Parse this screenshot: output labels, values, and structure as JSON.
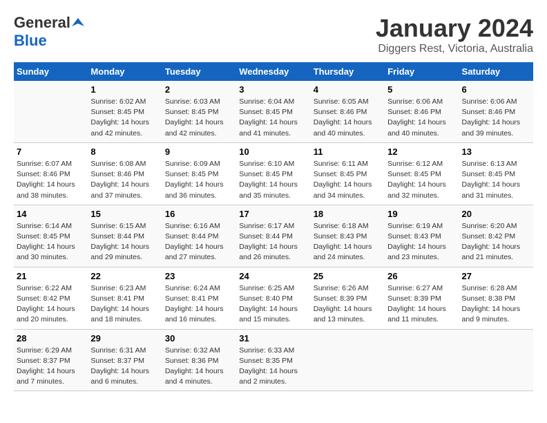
{
  "header": {
    "logo_general": "General",
    "logo_blue": "Blue",
    "title": "January 2024",
    "subtitle": "Diggers Rest, Victoria, Australia"
  },
  "days_of_week": [
    "Sunday",
    "Monday",
    "Tuesday",
    "Wednesday",
    "Thursday",
    "Friday",
    "Saturday"
  ],
  "weeks": [
    [
      {
        "day": "",
        "content": ""
      },
      {
        "day": "1",
        "content": "Sunrise: 6:02 AM\nSunset: 8:45 PM\nDaylight: 14 hours\nand 42 minutes."
      },
      {
        "day": "2",
        "content": "Sunrise: 6:03 AM\nSunset: 8:45 PM\nDaylight: 14 hours\nand 42 minutes."
      },
      {
        "day": "3",
        "content": "Sunrise: 6:04 AM\nSunset: 8:45 PM\nDaylight: 14 hours\nand 41 minutes."
      },
      {
        "day": "4",
        "content": "Sunrise: 6:05 AM\nSunset: 8:46 PM\nDaylight: 14 hours\nand 40 minutes."
      },
      {
        "day": "5",
        "content": "Sunrise: 6:06 AM\nSunset: 8:46 PM\nDaylight: 14 hours\nand 40 minutes."
      },
      {
        "day": "6",
        "content": "Sunrise: 6:06 AM\nSunset: 8:46 PM\nDaylight: 14 hours\nand 39 minutes."
      }
    ],
    [
      {
        "day": "7",
        "content": "Sunrise: 6:07 AM\nSunset: 8:46 PM\nDaylight: 14 hours\nand 38 minutes."
      },
      {
        "day": "8",
        "content": "Sunrise: 6:08 AM\nSunset: 8:46 PM\nDaylight: 14 hours\nand 37 minutes."
      },
      {
        "day": "9",
        "content": "Sunrise: 6:09 AM\nSunset: 8:45 PM\nDaylight: 14 hours\nand 36 minutes."
      },
      {
        "day": "10",
        "content": "Sunrise: 6:10 AM\nSunset: 8:45 PM\nDaylight: 14 hours\nand 35 minutes."
      },
      {
        "day": "11",
        "content": "Sunrise: 6:11 AM\nSunset: 8:45 PM\nDaylight: 14 hours\nand 34 minutes."
      },
      {
        "day": "12",
        "content": "Sunrise: 6:12 AM\nSunset: 8:45 PM\nDaylight: 14 hours\nand 32 minutes."
      },
      {
        "day": "13",
        "content": "Sunrise: 6:13 AM\nSunset: 8:45 PM\nDaylight: 14 hours\nand 31 minutes."
      }
    ],
    [
      {
        "day": "14",
        "content": "Sunrise: 6:14 AM\nSunset: 8:45 PM\nDaylight: 14 hours\nand 30 minutes."
      },
      {
        "day": "15",
        "content": "Sunrise: 6:15 AM\nSunset: 8:44 PM\nDaylight: 14 hours\nand 29 minutes."
      },
      {
        "day": "16",
        "content": "Sunrise: 6:16 AM\nSunset: 8:44 PM\nDaylight: 14 hours\nand 27 minutes."
      },
      {
        "day": "17",
        "content": "Sunrise: 6:17 AM\nSunset: 8:44 PM\nDaylight: 14 hours\nand 26 minutes."
      },
      {
        "day": "18",
        "content": "Sunrise: 6:18 AM\nSunset: 8:43 PM\nDaylight: 14 hours\nand 24 minutes."
      },
      {
        "day": "19",
        "content": "Sunrise: 6:19 AM\nSunset: 8:43 PM\nDaylight: 14 hours\nand 23 minutes."
      },
      {
        "day": "20",
        "content": "Sunrise: 6:20 AM\nSunset: 8:42 PM\nDaylight: 14 hours\nand 21 minutes."
      }
    ],
    [
      {
        "day": "21",
        "content": "Sunrise: 6:22 AM\nSunset: 8:42 PM\nDaylight: 14 hours\nand 20 minutes."
      },
      {
        "day": "22",
        "content": "Sunrise: 6:23 AM\nSunset: 8:41 PM\nDaylight: 14 hours\nand 18 minutes."
      },
      {
        "day": "23",
        "content": "Sunrise: 6:24 AM\nSunset: 8:41 PM\nDaylight: 14 hours\nand 16 minutes."
      },
      {
        "day": "24",
        "content": "Sunrise: 6:25 AM\nSunset: 8:40 PM\nDaylight: 14 hours\nand 15 minutes."
      },
      {
        "day": "25",
        "content": "Sunrise: 6:26 AM\nSunset: 8:39 PM\nDaylight: 14 hours\nand 13 minutes."
      },
      {
        "day": "26",
        "content": "Sunrise: 6:27 AM\nSunset: 8:39 PM\nDaylight: 14 hours\nand 11 minutes."
      },
      {
        "day": "27",
        "content": "Sunrise: 6:28 AM\nSunset: 8:38 PM\nDaylight: 14 hours\nand 9 minutes."
      }
    ],
    [
      {
        "day": "28",
        "content": "Sunrise: 6:29 AM\nSunset: 8:37 PM\nDaylight: 14 hours\nand 7 minutes."
      },
      {
        "day": "29",
        "content": "Sunrise: 6:31 AM\nSunset: 8:37 PM\nDaylight: 14 hours\nand 6 minutes."
      },
      {
        "day": "30",
        "content": "Sunrise: 6:32 AM\nSunset: 8:36 PM\nDaylight: 14 hours\nand 4 minutes."
      },
      {
        "day": "31",
        "content": "Sunrise: 6:33 AM\nSunset: 8:35 PM\nDaylight: 14 hours\nand 2 minutes."
      },
      {
        "day": "",
        "content": ""
      },
      {
        "day": "",
        "content": ""
      },
      {
        "day": "",
        "content": ""
      }
    ]
  ]
}
